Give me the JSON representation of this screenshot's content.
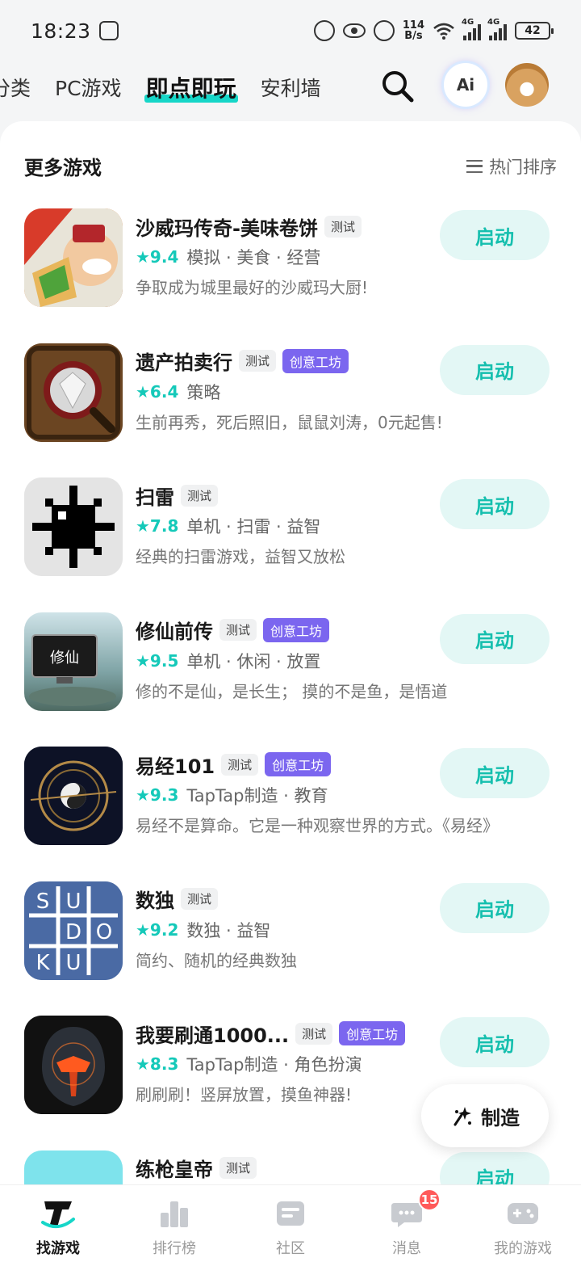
{
  "status_bar": {
    "time": "18:23",
    "net_speed_value": "114",
    "net_speed_unit": "B/s",
    "signal1_label": "4G",
    "signal2_label": "4G",
    "battery": "42"
  },
  "top_nav": {
    "tabs": [
      {
        "label": "分类",
        "active": false
      },
      {
        "label": "PC游戏",
        "active": false
      },
      {
        "label": "即点即玩",
        "active": true
      },
      {
        "label": "安利墙",
        "active": false
      }
    ],
    "ai_label": "Ai"
  },
  "section": {
    "title": "更多游戏",
    "sort_label": "热门排序"
  },
  "games": [
    {
      "name": "沙威玛传奇-美味卷饼",
      "tags": [
        "测试"
      ],
      "rating": "★9.4",
      "genres": "模拟 · 美食 · 经营",
      "desc": "争取成为城里最好的沙威玛大厨!",
      "button": "启动",
      "icon_text": "Shawarma"
    },
    {
      "name": "遗产拍卖行",
      "tags": [
        "测试",
        "创意工坊"
      ],
      "rating": "★6.4",
      "genres": "策略",
      "desc": "生前再秀，死后照旧，鼠鼠刘涛，0元起售!",
      "button": "启动"
    },
    {
      "name": "扫雷",
      "tags": [
        "测试"
      ],
      "rating": "★7.8",
      "genres": "单机 · 扫雷 · 益智",
      "desc": "经典的扫雷游戏，益智又放松",
      "button": "启动"
    },
    {
      "name": "修仙前传",
      "tags": [
        "测试",
        "创意工坊"
      ],
      "rating": "★9.5",
      "genres": "单机 · 休闲 · 放置",
      "desc": "修的不是仙，是长生； 摸的不是鱼，是悟道",
      "button": "启动",
      "icon_text": "修仙"
    },
    {
      "name": "易经101",
      "tags": [
        "测试",
        "创意工坊"
      ],
      "rating": "★9.3",
      "genres": "TapTap制造 · 教育",
      "desc": "易经不是算命。它是一种观察世界的方式。《易经》",
      "button": "启动"
    },
    {
      "name": "数独",
      "tags": [
        "测试"
      ],
      "rating": "★9.2",
      "genres": "数独 · 益智",
      "desc": "简约、随机的经典数独",
      "button": "启动",
      "icon_cells": [
        "S",
        "U",
        "",
        "",
        "D",
        "O",
        "K",
        "U",
        ""
      ]
    },
    {
      "name": "我要刷通1000...",
      "tags": [
        "测试",
        "创意工坊"
      ],
      "rating": "★8.3",
      "genres": "TapTap制造 · 角色扮演",
      "desc": "刷刷刷！竖屏放置，摸鱼神器!",
      "button": "启动"
    },
    {
      "name": "练枪皇帝",
      "tags": [
        "测试"
      ],
      "rating": "",
      "genres": "",
      "desc": "",
      "button": "启动"
    }
  ],
  "fab": {
    "label": "制造"
  },
  "bottom_nav": [
    {
      "label": "找游戏",
      "icon": "taptap-logo-icon",
      "active": true
    },
    {
      "label": "排行榜",
      "icon": "ranking-icon",
      "active": false
    },
    {
      "label": "社区",
      "icon": "community-icon",
      "active": false
    },
    {
      "label": "消息",
      "icon": "message-icon",
      "active": false,
      "badge": "15"
    },
    {
      "label": "我的游戏",
      "icon": "gamepad-icon",
      "active": false
    }
  ],
  "colors": {
    "accent": "#15c9b9",
    "workshop_tag": "#7b66ef",
    "button_bg": "#e3f7f5"
  }
}
